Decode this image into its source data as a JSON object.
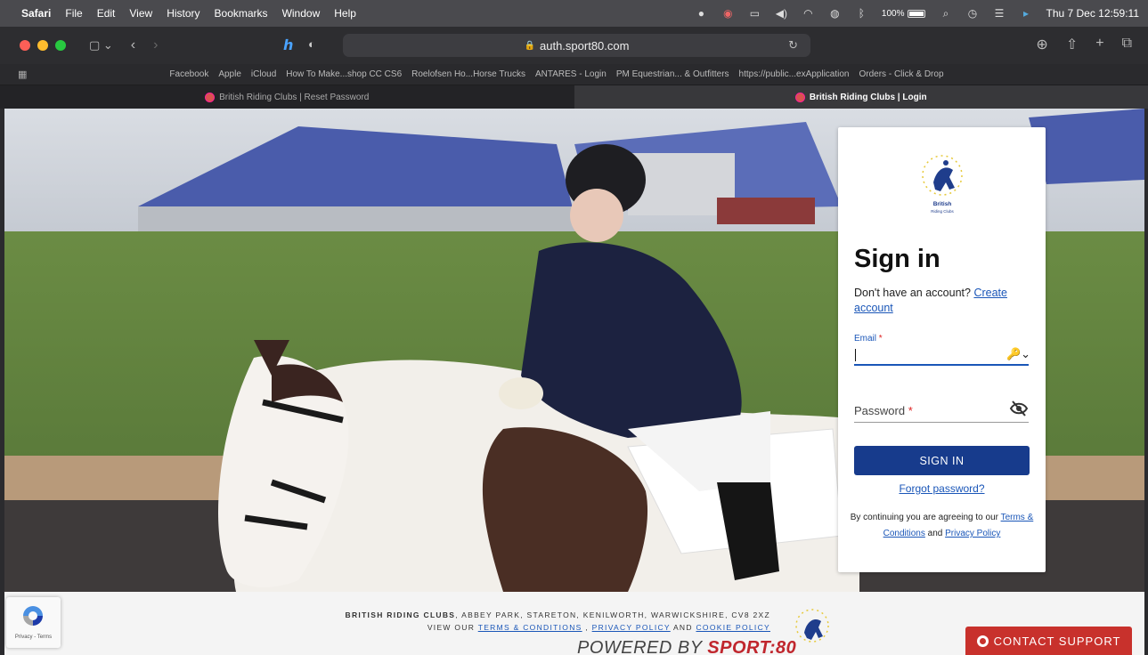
{
  "menubar": {
    "app": "Safari",
    "items": [
      "File",
      "Edit",
      "View",
      "History",
      "Bookmarks",
      "Window",
      "Help"
    ],
    "battery": "100%",
    "clock": "Thu 7 Dec  12:59:11"
  },
  "toolbar": {
    "url": "auth.sport80.com"
  },
  "favorites": [
    "Facebook",
    "Apple",
    "iCloud",
    "How To Make...shop CC CS6",
    "Roelofsen Ho...Horse Trucks",
    "ANTARES - Login",
    "PM Equestrian... & Outfitters",
    "https://public...exApplication",
    "Orders - Click & Drop"
  ],
  "tabs": [
    {
      "title": "British Riding Clubs | Reset Password",
      "active": false
    },
    {
      "title": "British Riding Clubs | Login",
      "active": true
    }
  ],
  "card": {
    "logo_text": [
      "British",
      "Riding Clubs"
    ],
    "title": "Sign in",
    "no_account": "Don't have an account?",
    "create_account": "Create account",
    "email_label": "Email",
    "email_value": "",
    "password_label": "Password",
    "signin_label": "SIGN IN",
    "forgot_label": "Forgot password?",
    "agree_prefix": "By continuing you are agreeing to our",
    "terms_link": "Terms & Conditions",
    "and": "and",
    "privacy_link": "Privacy Policy",
    "required_mark": "*"
  },
  "footer": {
    "org": "BRITISH RIDING CLUBS",
    "address": ", ABBEY PARK, STARETON, KENILWORTH, WARWICKSHIRE, CV8 2XZ",
    "view_our": "VIEW OUR",
    "terms": "TERMS & CONDITIONS",
    "comma": ",",
    "privacy": "PRIVACY POLICY",
    "and": "AND",
    "cookie": "COOKIE POLICY",
    "powered_prefix": "POWERED BY",
    "powered_brand": "SPORT:80",
    "recaptcha": "Privacy - Terms",
    "contact": "CONTACT SUPPORT"
  },
  "colors": {
    "brand_blue": "#173b8c",
    "link_blue": "#1a56b8",
    "contact_red": "#c8312c"
  },
  "icons": [
    "apple-icon",
    "sidebar-icon",
    "back-icon",
    "forward-icon",
    "shield-icon",
    "lock-icon",
    "reload-icon",
    "download-icon",
    "share-icon",
    "new-tab-icon",
    "tabs-overview-icon",
    "key-icon",
    "eye-off-icon",
    "lifebuoy-icon",
    "recaptcha-icon"
  ]
}
